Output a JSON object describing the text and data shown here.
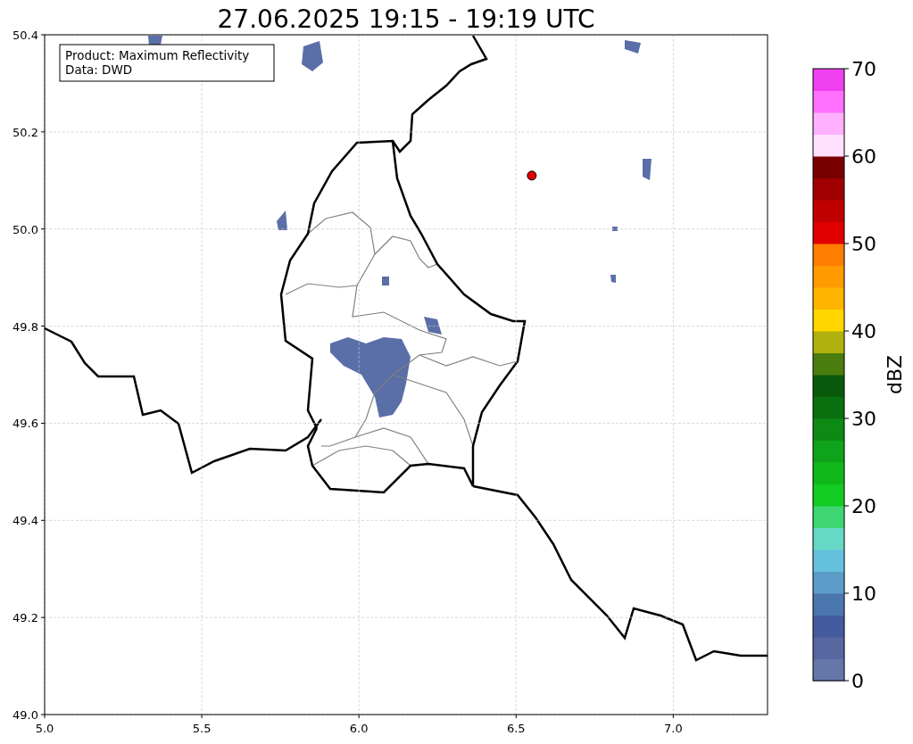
{
  "figure": {
    "chart_data": {
      "type": "scatter",
      "grid": true,
      "title": "27.06.2025 19:15 - 19:19 UTC",
      "x": [
        6.55
      ],
      "series": [
        {
          "color": "#e00000",
          "values": [
            50.11
          ]
        }
      ],
      "xlim": [
        5,
        7.3
      ],
      "ylim": [
        49,
        50.4
      ],
      "xticks": [
        {
          "value": 5,
          "label": "5.0"
        },
        {
          "value": 5.5,
          "label": "5.5"
        },
        {
          "value": 6,
          "label": "6.0"
        },
        {
          "value": 6.5,
          "label": "6.5"
        },
        {
          "value": 7,
          "label": "7.0"
        }
      ],
      "yticks": [
        {
          "value": 49,
          "label": "49.0"
        },
        {
          "value": 49.2,
          "label": "49.2"
        },
        {
          "value": 49.4,
          "label": "49.4"
        },
        {
          "value": 49.6,
          "label": "49.6"
        },
        {
          "value": 49.8,
          "label": "49.8"
        },
        {
          "value": 50,
          "label": "50.0"
        },
        {
          "value": 50.2,
          "label": "50.2"
        },
        {
          "value": 50.4,
          "label": "50.4"
        }
      ]
    }
  },
  "annotation": {
    "lines": [
      "Product: Maximum Reflectivity",
      "Data: DWD"
    ]
  },
  "colorbar": {
    "label": "dBZ",
    "ticks": [
      "70",
      "60",
      "50",
      "40",
      "30",
      "20",
      "10",
      "0"
    ],
    "bands": [
      {
        "color": "#6577a8"
      },
      {
        "color": "#5767a0"
      },
      {
        "color": "#445c9e"
      },
      {
        "color": "#4a77ae"
      },
      {
        "color": "#5b9dc8"
      },
      {
        "color": "#66c1df"
      },
      {
        "color": "#66d9c6"
      },
      {
        "color": "#3ed673"
      },
      {
        "color": "#13cc22"
      },
      {
        "color": "#10b81a"
      },
      {
        "color": "#0ea31a"
      },
      {
        "color": "#0c8a14"
      },
      {
        "color": "#0a7010"
      },
      {
        "color": "#0a5a0e"
      },
      {
        "color": "#4a7c0e"
      },
      {
        "color": "#b0b00e"
      },
      {
        "color": "#ffd600"
      },
      {
        "color": "#ffb400"
      },
      {
        "color": "#ff9a00"
      },
      {
        "color": "#ff7d00"
      },
      {
        "color": "#e00000"
      },
      {
        "color": "#c00000"
      },
      {
        "color": "#a00000"
      },
      {
        "color": "#780000"
      },
      {
        "color": "#ffe0ff"
      },
      {
        "color": "#ffb0ff"
      },
      {
        "color": "#ff70ff"
      },
      {
        "color": "#f03ff0"
      }
    ]
  }
}
